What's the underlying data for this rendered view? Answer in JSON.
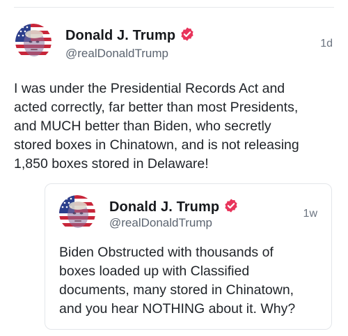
{
  "post": {
    "author": {
      "display_name": "Donald J. Trump",
      "handle": "@realDonaldTrump",
      "verified": true,
      "avatar_icon": "profile-photo-flag-avatar"
    },
    "timestamp": "1d",
    "text_lines": [
      "I was under the Presidential Records Act and",
      "acted correctly, far better than most Presidents,",
      "and MUCH better than Biden, who secretly",
      "stored boxes in Chinatown, and is not releasing",
      "1,850 boxes stored in Delaware!"
    ]
  },
  "quoted_post": {
    "author": {
      "display_name": "Donald J. Trump",
      "handle": "@realDonaldTrump",
      "verified": true,
      "avatar_icon": "profile-photo-flag-avatar"
    },
    "timestamp": "1w",
    "text_lines": [
      "Biden Obstructed with thousands of",
      "boxes loaded up with Classified",
      "documents, many stored in Chinatown,",
      "and you hear NOTHING about it. Why?"
    ]
  },
  "colors": {
    "verified_badge": "#e8345b",
    "divider": "#e6e8eb",
    "secondary_text": "#5b6470"
  }
}
